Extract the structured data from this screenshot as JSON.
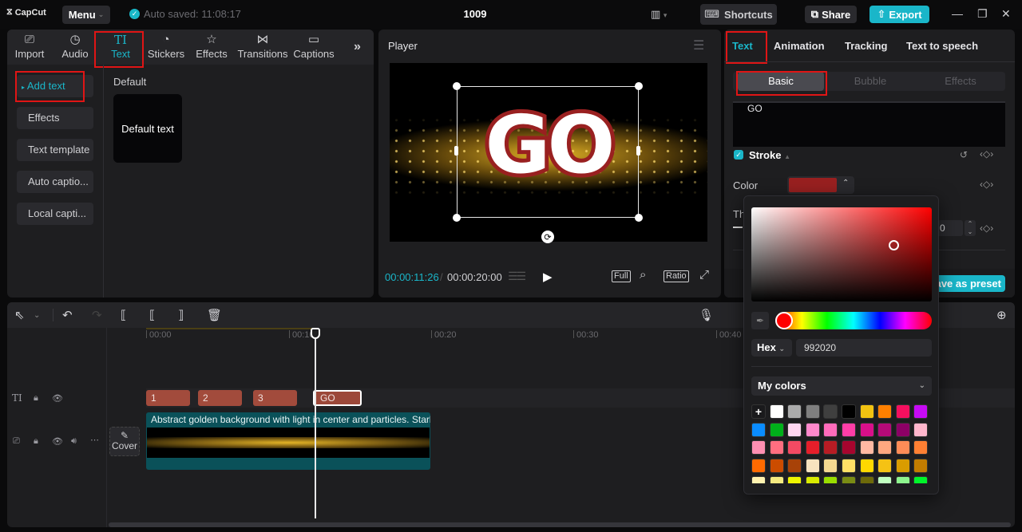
{
  "app": {
    "logo": "CapCut",
    "menu_label": "Menu",
    "autosave": "Auto saved: 11:08:17",
    "project_title": "1009"
  },
  "titlebar": {
    "shortcuts_label": "Shortcuts",
    "share_label": "Share",
    "export_label": "Export",
    "accent": "#1ab6c9"
  },
  "media_tabs": [
    {
      "label": "Import",
      "icon": "import-icon",
      "glyph": "▶"
    },
    {
      "label": "Audio",
      "icon": "audio-icon",
      "glyph": "♪"
    },
    {
      "label": "Text",
      "icon": "text-icon",
      "glyph": "TI"
    },
    {
      "label": "Stickers",
      "icon": "sticker-icon",
      "glyph": "◔"
    },
    {
      "label": "Effects",
      "icon": "effects-icon",
      "glyph": "✩"
    },
    {
      "label": "Transitions",
      "icon": "transitions-icon",
      "glyph": "⋈"
    },
    {
      "label": "Captions",
      "icon": "captions-icon",
      "glyph": "▭"
    }
  ],
  "text_sidebar": [
    "Add text",
    "Effects",
    "Text template",
    "Auto captio...",
    "Local capti..."
  ],
  "text_library": {
    "section": "Default",
    "card_label": "Default text"
  },
  "player": {
    "title": "Player",
    "overlay_text": "GO",
    "current_time": "00:00:11:26",
    "separator": "/",
    "total_time": "00:00:20:00",
    "full_label": "Full",
    "ratio_label": "Ratio"
  },
  "properties": {
    "tabs": [
      "Text",
      "Animation",
      "Tracking",
      "Text to speech"
    ],
    "subtabs": [
      "Basic",
      "Bubble",
      "Effects"
    ],
    "text_value": "GO",
    "stroke_label": "Stroke",
    "stroke_enabled": true,
    "color_label": "Color",
    "stroke_color": "#992020",
    "thickness_label": "Th",
    "thickness_value": "0",
    "save_preset_label": "ave as preset"
  },
  "color_picker": {
    "hex_mode": "Hex",
    "hex_value": "992020",
    "my_colors_label": "My colors",
    "swatches": [
      "#ffffff",
      "#ababab",
      "#7f7f7f",
      "#3f3f3f",
      "#000000",
      "#f2c311",
      "#ff8000",
      "#f50f5f",
      "#c70af5",
      "#0a8cff",
      "#00b01a",
      "#ffd6f0",
      "#ff88cc",
      "#ff6bbb",
      "#ff3da6",
      "#d90f8a",
      "#b50a78",
      "#8c0066",
      "#ffb6cc",
      "#ff8fb2",
      "#ff6e80",
      "#f44a63",
      "#e61e2a",
      "#b81c24",
      "#a6052e",
      "#ffb9a3",
      "#ffa880",
      "#ff8c57",
      "#ff8033",
      "#ff6a00",
      "#cc4c00",
      "#a84208",
      "#f7e3bf",
      "#f5d991",
      "#ffe066",
      "#ffd800",
      "#f5c214",
      "#d99c00",
      "#c27c00",
      "#fff2b0",
      "#f5ea80",
      "#eef500",
      "#d9eb00",
      "#9ade00",
      "#7a8c14",
      "#6e6a0a",
      "#c1ffc1",
      "#8ef58e",
      "#00f52a"
    ]
  },
  "timeline": {
    "ruler": [
      "00:00",
      "00:10",
      "00:20",
      "00:30",
      "00:40"
    ],
    "text_clips": [
      "1",
      "2",
      "3",
      "GO"
    ],
    "video_clip_caption": "Abstract golden background with light in center and particles. Starl",
    "cover_label": "Cover"
  }
}
